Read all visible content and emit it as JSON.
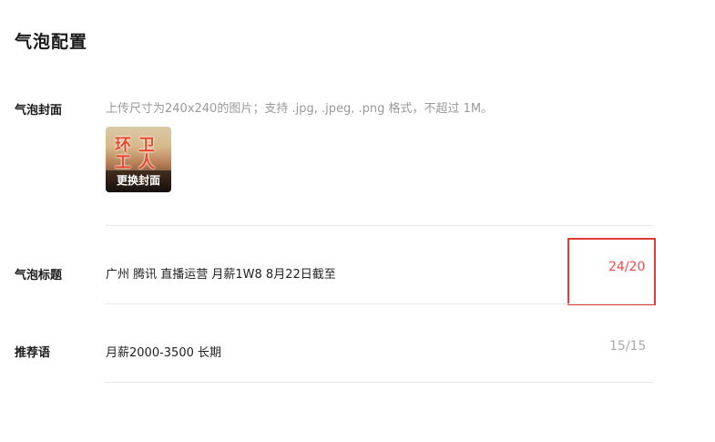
{
  "page": {
    "title": "气泡配置"
  },
  "cover_section": {
    "label": "气泡封面",
    "hint": "上传尺寸为240x240的图片；支持 .jpg, .jpeg, .png 格式，不超过 1M。",
    "image_text_line1": "环卫",
    "image_text_line2": "工人",
    "change_label": "更换封面"
  },
  "title_section": {
    "label": "气泡标题",
    "value": "广州 腾讯 直播运营 月薪1W8 8月22日截至",
    "counter": "24/20"
  },
  "recommend_section": {
    "label": "推荐语",
    "value": "月薪2000-3500  长期",
    "counter": "15/15"
  },
  "colors": {
    "over_limit": "#f04b4b",
    "highlight": "#e53935",
    "muted": "#aaaaaa"
  }
}
